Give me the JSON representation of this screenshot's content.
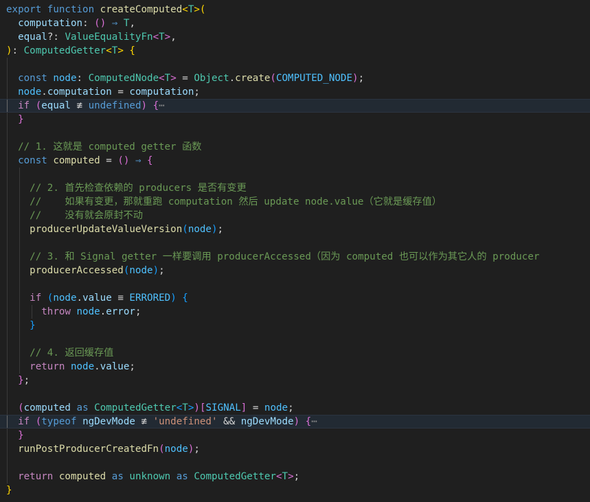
{
  "editor": {
    "lines": [
      [
        [
          "kw",
          "export "
        ],
        [
          "kw",
          "function "
        ],
        [
          "fn",
          "createComputed"
        ],
        [
          "b1",
          "<"
        ],
        [
          "ty",
          "T"
        ],
        [
          "b1",
          ">"
        ],
        [
          "b1",
          "("
        ]
      ],
      [
        [
          "pl",
          "  "
        ],
        [
          "vr",
          "computation"
        ],
        [
          "pl",
          ": "
        ],
        [
          "b2",
          "()"
        ],
        [
          "pl",
          " "
        ],
        [
          "kw",
          "⇒"
        ],
        [
          "pl",
          " "
        ],
        [
          "ty",
          "T"
        ],
        [
          "pl",
          ","
        ]
      ],
      [
        [
          "pl",
          "  "
        ],
        [
          "vr",
          "equal"
        ],
        [
          "pl",
          "?: "
        ],
        [
          "ty",
          "ValueEqualityFn"
        ],
        [
          "b2",
          "<"
        ],
        [
          "ty",
          "T"
        ],
        [
          "b2",
          ">"
        ],
        [
          "pl",
          ","
        ]
      ],
      [
        [
          "b1",
          ")"
        ],
        [
          "pl",
          ": "
        ],
        [
          "ty",
          "ComputedGetter"
        ],
        [
          "b1",
          "<"
        ],
        [
          "ty",
          "T"
        ],
        [
          "b1",
          ">"
        ],
        [
          "pl",
          " "
        ],
        [
          "b1",
          "{"
        ]
      ],
      [],
      [
        [
          "pl",
          "  "
        ],
        [
          "kw",
          "const "
        ],
        [
          "cn",
          "node"
        ],
        [
          "pl",
          ": "
        ],
        [
          "ty",
          "ComputedNode"
        ],
        [
          "b2",
          "<"
        ],
        [
          "ty",
          "T"
        ],
        [
          "b2",
          ">"
        ],
        [
          "pl",
          " = "
        ],
        [
          "ty",
          "Object"
        ],
        [
          "pl",
          "."
        ],
        [
          "fn",
          "create"
        ],
        [
          "b2",
          "("
        ],
        [
          "cn",
          "COMPUTED_NODE"
        ],
        [
          "b2",
          ")"
        ],
        [
          "pl",
          ";"
        ]
      ],
      [
        [
          "pl",
          "  "
        ],
        [
          "cn",
          "node"
        ],
        [
          "pl",
          "."
        ],
        [
          "vr",
          "computation"
        ],
        [
          "pl",
          " = "
        ],
        [
          "vr",
          "computation"
        ],
        [
          "pl",
          ";"
        ]
      ],
      [
        [
          "pl",
          "  "
        ],
        [
          "ctl",
          "if "
        ],
        [
          "b2",
          "("
        ],
        [
          "vr",
          "equal"
        ],
        [
          "pl",
          " ≢ "
        ],
        [
          "kw",
          "undefined"
        ],
        [
          "b2",
          ")"
        ],
        [
          "pl",
          " "
        ],
        [
          "b2",
          "{"
        ],
        [
          "fold",
          "⋯"
        ]
      ],
      [
        [
          "pl",
          "  "
        ],
        [
          "b2",
          "}"
        ]
      ],
      [],
      [
        [
          "pl",
          "  "
        ],
        [
          "cm",
          "// 1. 这就是 computed getter 函数"
        ]
      ],
      [
        [
          "pl",
          "  "
        ],
        [
          "kw",
          "const "
        ],
        [
          "fn",
          "computed"
        ],
        [
          "pl",
          " = "
        ],
        [
          "b2",
          "()"
        ],
        [
          "pl",
          " "
        ],
        [
          "kw",
          "⇒"
        ],
        [
          "pl",
          " "
        ],
        [
          "b2",
          "{"
        ]
      ],
      [],
      [
        [
          "pl",
          "    "
        ],
        [
          "cm",
          "// 2. 首先检查依赖的 producers 是否有变更"
        ]
      ],
      [
        [
          "pl",
          "    "
        ],
        [
          "cm",
          "//    如果有变更，那就重跑 computation 然后 update node.value（它就是缓存值）"
        ]
      ],
      [
        [
          "pl",
          "    "
        ],
        [
          "cm",
          "//    没有就会原封不动"
        ]
      ],
      [
        [
          "pl",
          "    "
        ],
        [
          "fn",
          "producerUpdateValueVersion"
        ],
        [
          "b3",
          "("
        ],
        [
          "cn",
          "node"
        ],
        [
          "b3",
          ")"
        ],
        [
          "pl",
          ";"
        ]
      ],
      [],
      [
        [
          "pl",
          "    "
        ],
        [
          "cm",
          "// 3. 和 Signal getter 一样要调用 producerAccessed（因为 computed 也可以作为其它人的 producer"
        ]
      ],
      [
        [
          "pl",
          "    "
        ],
        [
          "fn",
          "producerAccessed"
        ],
        [
          "b3",
          "("
        ],
        [
          "cn",
          "node"
        ],
        [
          "b3",
          ")"
        ],
        [
          "pl",
          ";"
        ]
      ],
      [],
      [
        [
          "pl",
          "    "
        ],
        [
          "ctl",
          "if "
        ],
        [
          "b3",
          "("
        ],
        [
          "cn",
          "node"
        ],
        [
          "pl",
          "."
        ],
        [
          "vr",
          "value"
        ],
        [
          "pl",
          " ≡ "
        ],
        [
          "cn",
          "ERRORED"
        ],
        [
          "b3",
          ")"
        ],
        [
          "pl",
          " "
        ],
        [
          "b3",
          "{"
        ]
      ],
      [
        [
          "pl",
          "      "
        ],
        [
          "ctl",
          "throw "
        ],
        [
          "cn",
          "node"
        ],
        [
          "pl",
          "."
        ],
        [
          "vr",
          "error"
        ],
        [
          "pl",
          ";"
        ]
      ],
      [
        [
          "pl",
          "    "
        ],
        [
          "b3",
          "}"
        ]
      ],
      [],
      [
        [
          "pl",
          "    "
        ],
        [
          "cm",
          "// 4. 返回缓存值"
        ]
      ],
      [
        [
          "pl",
          "    "
        ],
        [
          "ctl",
          "return "
        ],
        [
          "cn",
          "node"
        ],
        [
          "pl",
          "."
        ],
        [
          "vr",
          "value"
        ],
        [
          "pl",
          ";"
        ]
      ],
      [
        [
          "pl",
          "  "
        ],
        [
          "b2",
          "}"
        ],
        [
          "pl",
          ";"
        ]
      ],
      [],
      [
        [
          "pl",
          "  "
        ],
        [
          "b2",
          "("
        ],
        [
          "vr",
          "computed"
        ],
        [
          "pl",
          " "
        ],
        [
          "kw",
          "as "
        ],
        [
          "ty",
          "ComputedGetter"
        ],
        [
          "b3",
          "<"
        ],
        [
          "ty",
          "T"
        ],
        [
          "b3",
          ">"
        ],
        [
          "b2",
          ")"
        ],
        [
          "b2",
          "["
        ],
        [
          "cn",
          "SIGNAL"
        ],
        [
          "b2",
          "]"
        ],
        [
          "pl",
          " = "
        ],
        [
          "cn",
          "node"
        ],
        [
          "pl",
          ";"
        ]
      ],
      [
        [
          "pl",
          "  "
        ],
        [
          "ctl",
          "if "
        ],
        [
          "b2",
          "("
        ],
        [
          "kw",
          "typeof "
        ],
        [
          "vr",
          "ngDevMode"
        ],
        [
          "pl",
          " ≢ "
        ],
        [
          "str",
          "'undefined'"
        ],
        [
          "pl",
          " && "
        ],
        [
          "vr",
          "ngDevMode"
        ],
        [
          "b2",
          ")"
        ],
        [
          "pl",
          " "
        ],
        [
          "b2",
          "{"
        ],
        [
          "fold",
          "⋯"
        ]
      ],
      [
        [
          "pl",
          "  "
        ],
        [
          "b2",
          "}"
        ]
      ],
      [
        [
          "pl",
          "  "
        ],
        [
          "fn",
          "runPostProducerCreatedFn"
        ],
        [
          "b2",
          "("
        ],
        [
          "cn",
          "node"
        ],
        [
          "b2",
          ")"
        ],
        [
          "pl",
          ";"
        ]
      ],
      [],
      [
        [
          "pl",
          "  "
        ],
        [
          "ctl",
          "return "
        ],
        [
          "fn",
          "computed"
        ],
        [
          "pl",
          " "
        ],
        [
          "kw",
          "as "
        ],
        [
          "ty",
          "unknown"
        ],
        [
          "pl",
          " "
        ],
        [
          "kw",
          "as "
        ],
        [
          "ty",
          "ComputedGetter"
        ],
        [
          "b2",
          "<"
        ],
        [
          "ty",
          "T"
        ],
        [
          "b2",
          ">"
        ],
        [
          "pl",
          ";"
        ]
      ],
      [
        [
          "b1",
          "}"
        ]
      ]
    ],
    "highlighted_lines": [
      7,
      30
    ],
    "indent_guides": [
      [],
      [],
      [],
      [],
      [
        1
      ],
      [
        1
      ],
      [
        1
      ],
      [
        1
      ],
      [
        1
      ],
      [
        1
      ],
      [
        1
      ],
      [
        1
      ],
      [
        1,
        2
      ],
      [
        1,
        2
      ],
      [
        1,
        2
      ],
      [
        1,
        2
      ],
      [
        1,
        2
      ],
      [
        1,
        2
      ],
      [
        1,
        2
      ],
      [
        1,
        2
      ],
      [
        1,
        2
      ],
      [
        1,
        2
      ],
      [
        1,
        2,
        3
      ],
      [
        1,
        2
      ],
      [
        1,
        2
      ],
      [
        1,
        2
      ],
      [
        1,
        2
      ],
      [
        1
      ],
      [
        1
      ],
      [
        1
      ],
      [
        1
      ],
      [
        1
      ],
      [
        1
      ],
      [
        1
      ],
      [
        1
      ],
      []
    ]
  }
}
